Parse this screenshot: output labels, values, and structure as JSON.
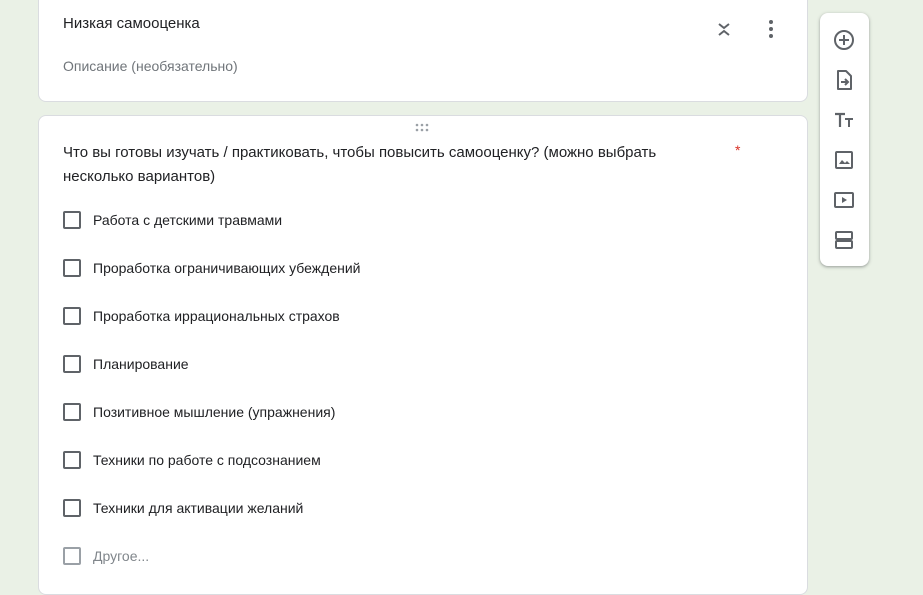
{
  "section": {
    "title": "Низкая самооценка",
    "description_placeholder": "Описание (необязательно)"
  },
  "question": {
    "text": "Что вы готовы изучать / практиковать, чтобы повысить самооценку? (можно выбрать несколько вариантов)",
    "required_mark": "*",
    "options": [
      "Работа с детскими травмами",
      "Проработка ограничивающих убеждений",
      "Проработка иррациональных страхов",
      "Планирование",
      "Позитивное мышление (упражнения)",
      "Техники по работе с подсознанием",
      "Техники для активации желаний"
    ],
    "other_label": "Другое..."
  },
  "toolbar": {
    "icons": [
      "add-question-icon",
      "import-questions-icon",
      "add-title-icon",
      "add-image-icon",
      "add-video-icon",
      "add-section-icon"
    ]
  },
  "colors": {
    "background": "#eaf1e6",
    "required": "#d93025",
    "icon": "#5f6368"
  }
}
